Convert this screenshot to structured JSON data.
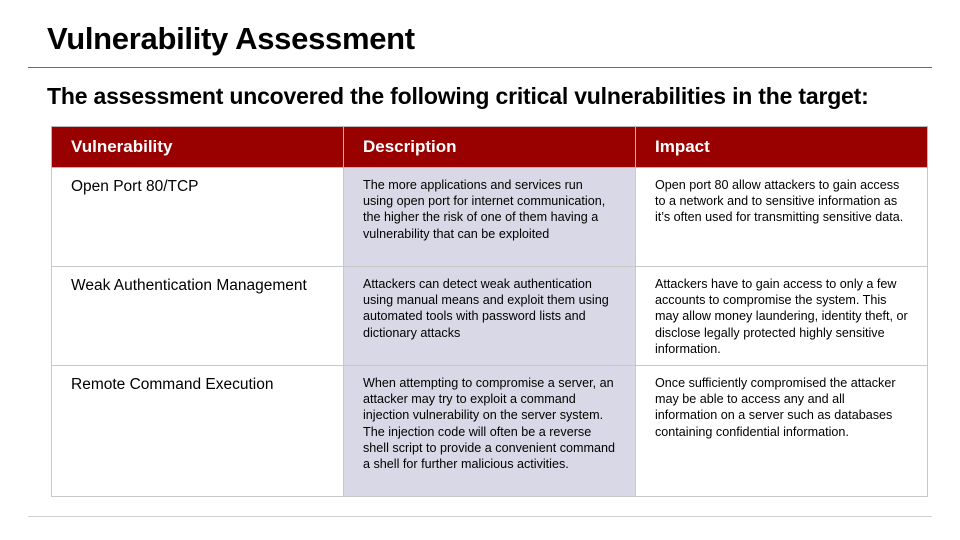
{
  "slide": {
    "title": "Vulnerability Assessment",
    "subtitle": "The assessment uncovered the following critical vulnerabilities in the target:"
  },
  "table": {
    "headers": [
      "Vulnerability",
      "Description",
      "Impact"
    ],
    "rows": [
      {
        "vulnerability": "Open Port 80/TCP",
        "description": "The more applications and services run using open port for internet communication, the higher the risk of one of them having a vulnerability that can be exploited",
        "impact": "Open port 80 allow attackers to gain access to a network and to sensitive information as it’s often used for transmitting sensitive data."
      },
      {
        "vulnerability": "Weak Authentication Management",
        "description": "Attackers can detect weak authentication using manual means and exploit them using automated tools with password lists and dictionary attacks",
        "impact": "Attackers have to gain access to only a few accounts to compromise the system. This may allow money laundering, identity theft, or disclose legally protected highly sensitive information."
      },
      {
        "vulnerability": "Remote Command Execution",
        "description": "When attempting to compromise a server, an attacker may try to exploit a command injection vulnerability on the server system. The injection code will often be a reverse shell script to provide a convenient command a shell for further malicious activities.",
        "impact": "Once sufficiently compromised the attacker may be able to access any and all information on a server such as databases containing confidential information."
      }
    ]
  },
  "colors": {
    "header_background": "#990000",
    "header_text": "#ffffff",
    "description_column_background": "#d9d8e6"
  }
}
